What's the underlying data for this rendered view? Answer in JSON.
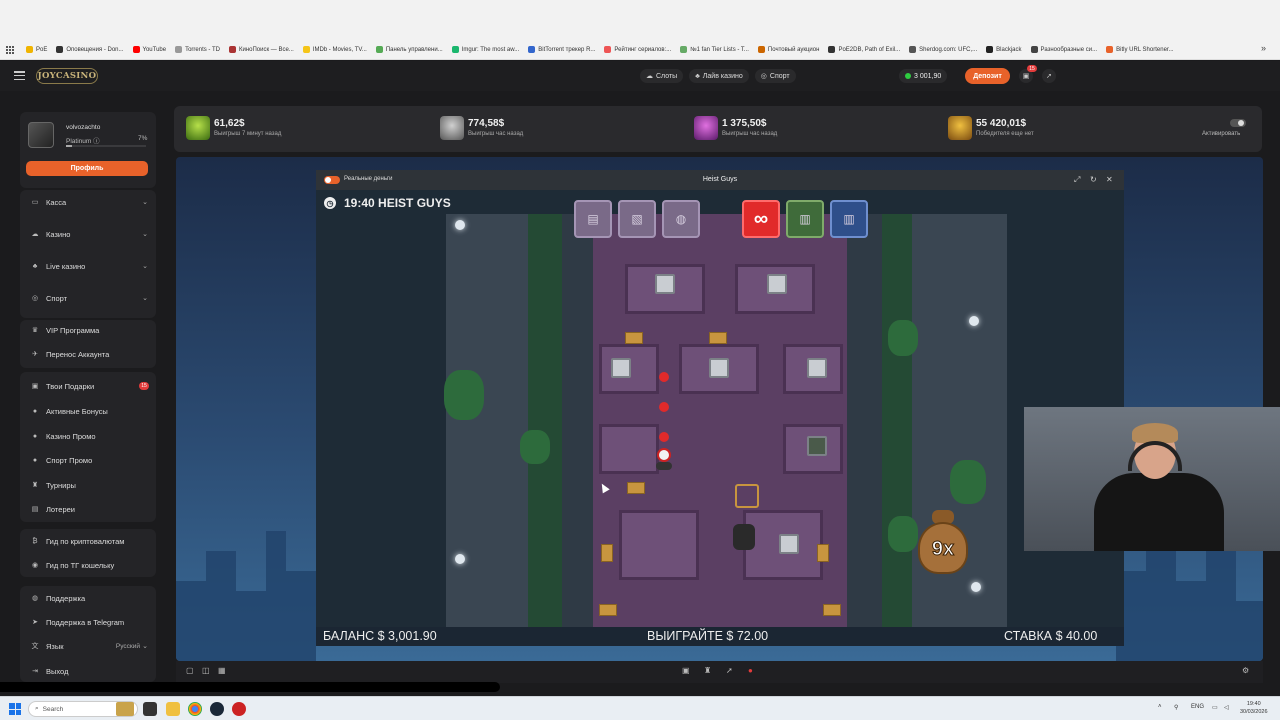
{
  "bookmarks": [
    "PoE",
    "Оповещения - Don...",
    "YouTube",
    "Torrents - TD",
    "КиноПоиск — Все...",
    "IMDb - Movies, TV...",
    "Панель управлени...",
    "Imgur: The most aw...",
    "BitTorrent трекер R...",
    "Рейтинг сериалов:...",
    "№1 fan Tier Lists - T...",
    "Почтовый аукцион",
    "PoE2DB, Path of Exil...",
    "Sherdog.com: UFC,...",
    "Blackjack",
    "Разнообразные си...",
    "Bitly URL Shortener..."
  ],
  "header": {
    "logo": "JOYCASINO",
    "nav": [
      {
        "label": "Слоты",
        "icon": "slots-icon"
      },
      {
        "label": "Лайв казино",
        "icon": "live-icon"
      },
      {
        "label": "Спорт",
        "icon": "sport-icon"
      }
    ],
    "balance": "3 001,90",
    "deposit": "Депозит",
    "gift_badge": "15"
  },
  "profile": {
    "username": "volvozachto",
    "tier": "Platinum",
    "tier_percent": "7%",
    "tier_progress": 0.07,
    "button": "Профиль"
  },
  "menu": {
    "group1": [
      "Касса",
      "Казино",
      "Live казино",
      "Спорт"
    ],
    "group2": [
      "VIP Программа",
      "Перенос Аккаунта"
    ],
    "group3": [
      "Твои Подарки",
      "Активные Бонусы",
      "Казино Промо",
      "Спорт Промо",
      "Турниры",
      "Лотереи"
    ],
    "gifts_badge": "15",
    "group4": [
      "Гид по криптовалютам",
      "Гид по ТГ кошельку"
    ],
    "group5": [
      "Поддержка",
      "Поддержка в Telegram",
      "Язык",
      "Выход"
    ],
    "language": "Русский"
  },
  "jackpots": [
    {
      "amount": "61,62$",
      "sub": "Выигрыш 7 минут назад"
    },
    {
      "amount": "774,58$",
      "sub": "Выигрыш час назад"
    },
    {
      "amount": "1 375,50$",
      "sub": "Выигрыш час назад"
    },
    {
      "amount": "55 420,01$",
      "sub": "Победителя еще нет"
    }
  ],
  "activate_label": "Активировать",
  "game": {
    "real_money": "Реальные деньги",
    "title": "Heist Guys",
    "clock": "19:40 HEIST GUYS",
    "multiplier": "9x",
    "infinity": "∞",
    "balance": "БАЛАНС $ 3,001.90",
    "win": "ВЫИГРАЙТЕ $ 72.00",
    "bet": "СТАВКА $ 40.00"
  },
  "taskbar": {
    "search": "Search",
    "lang": "ENG",
    "time": "19:40",
    "date": "30/03/2026"
  }
}
